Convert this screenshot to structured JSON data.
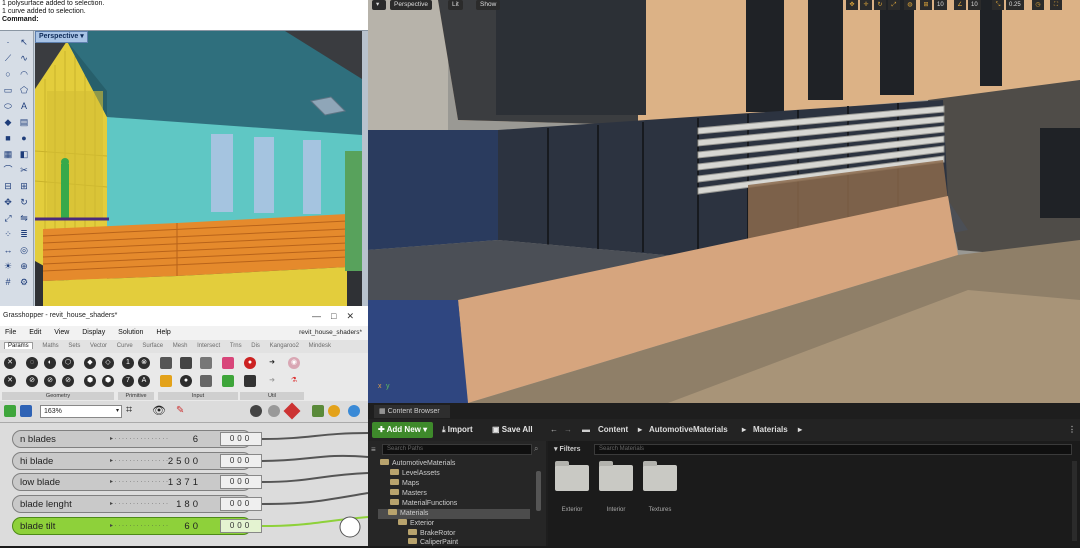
{
  "rhino": {
    "history": [
      "1 polysurface added to selection.",
      "1 curve added to selection."
    ],
    "command_label": "Command:",
    "viewport_tab": "Perspective"
  },
  "grasshopper": {
    "title": "Grasshopper - revit_house_shaders*",
    "menu": [
      "File",
      "Edit",
      "View",
      "Display",
      "Solution",
      "Help"
    ],
    "document_name": "revit_house_shaders*",
    "tabs": [
      "Params",
      "Maths",
      "Sets",
      "Vector",
      "Curve",
      "Surface",
      "Mesh",
      "Intersect",
      "Trns",
      "Dis",
      "Kangaroo2",
      "Mindesk"
    ],
    "ribbon_groups": [
      "Geometry",
      "Primitive",
      "Input",
      "Util"
    ],
    "zoom": "163%",
    "sliders": [
      {
        "label": "n blades",
        "value": "6",
        "output": "000"
      },
      {
        "label": "hi blade",
        "value": "2500",
        "output": "000"
      },
      {
        "label": "low blade",
        "value": "1371",
        "output": "000"
      },
      {
        "label": "blade lenght",
        "value": "180",
        "output": "000"
      },
      {
        "label": "blade tilt",
        "value": "60",
        "output": "000"
      }
    ]
  },
  "unreal": {
    "viewport": {
      "perspective_label": "Perspective",
      "lit_label": "Lit",
      "show_label": "Show",
      "snap_values": [
        "10",
        "10",
        "0.25"
      ]
    },
    "content_browser": {
      "tab_label": "Content Browser",
      "add_new": "Add New",
      "import": "Import",
      "save_all": "Save All",
      "breadcrumb": [
        "Content",
        "AutomotiveMaterials",
        "Materials"
      ],
      "search_paths_placeholder": "Search Paths",
      "filters_label": "Filters",
      "search_assets_placeholder": "Search Materials",
      "tree": [
        "AutomotiveMaterials",
        "LevelAssets",
        "Maps",
        "Masters",
        "MaterialFunctions",
        "Materials",
        "Exterior",
        "BrakeRotor",
        "CaliperPaint"
      ],
      "assets": [
        "Exterior",
        "Interior",
        "Textures"
      ]
    }
  },
  "colors": {
    "accent_green": "#3e8a2b",
    "slider_selected": "#8ed13a",
    "folder": "#b8a36d"
  }
}
